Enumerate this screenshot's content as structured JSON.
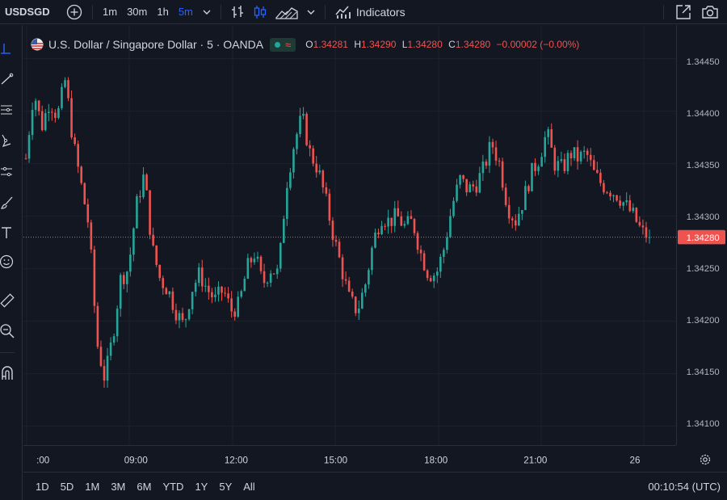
{
  "toolbar": {
    "symbol": "USDSGD",
    "intervals": [
      {
        "label": "1m",
        "active": false
      },
      {
        "label": "30m",
        "active": false
      },
      {
        "label": "1h",
        "active": false
      },
      {
        "label": "5m",
        "active": true
      }
    ],
    "indicators_label": "Indicators",
    "icons": [
      "add-symbol-icon",
      "chevron-down-icon",
      "bar-style-icon",
      "candle-style-icon",
      "area-style-icon",
      "chevron-down-icon",
      "indicators-icon",
      "fullscreen-icon",
      "camera-icon"
    ]
  },
  "legend": {
    "title": "U.S. Dollar / Singapore Dollar · 5 · OANDA",
    "ohlc": [
      {
        "k": "O",
        "v": "1.34281"
      },
      {
        "k": "H",
        "v": "1.34290"
      },
      {
        "k": "L",
        "v": "1.34280"
      },
      {
        "k": "C",
        "v": "1.34280"
      }
    ],
    "change": "−0.00002 (−0.00%)"
  },
  "left_tools": [
    "crosshair-icon",
    "trendline-icon",
    "fib-icon",
    "brush-icon",
    "pattern-icon",
    "forecast-icon",
    "text-icon",
    "emoji-icon",
    "ruler-icon",
    "zoom-icon",
    "magnet-icon"
  ],
  "bottom": {
    "ranges": [
      "1D",
      "5D",
      "1M",
      "3M",
      "6M",
      "YTD",
      "1Y",
      "5Y",
      "All"
    ],
    "clock": "00:10:54 (UTC)"
  },
  "colors": {
    "up": "#26a69a",
    "down": "#ef5350",
    "bg": "#131722",
    "grid": "#1e222d"
  },
  "chart_data": {
    "type": "candlestick",
    "price_ticks": [
      "1.34450",
      "1.34400",
      "1.34350",
      "1.34300",
      "1.34250",
      "1.34200",
      "1.34150",
      "1.34100"
    ],
    "time_ticks": [
      ":00",
      "09:00",
      "12:00",
      "15:00",
      "18:00",
      "21:00",
      "26"
    ],
    "last_price": "1.34280",
    "ylim": [
      1.34082,
      1.34482
    ],
    "close_path": [
      1.34355,
      1.3442,
      1.34385,
      1.3441,
      1.34395,
      1.3443,
      1.3437,
      1.3433,
      1.3429,
      1.3418,
      1.34145,
      1.34185,
      1.3424,
      1.3425,
      1.3431,
      1.3434,
      1.3427,
      1.3424,
      1.3423,
      1.3421,
      1.34195,
      1.3423,
      1.34245,
      1.3423,
      1.3422,
      1.3423,
      1.3421,
      1.34215,
      1.3425,
      1.34265,
      1.34235,
      1.3425,
      1.34245,
      1.3433,
      1.3437,
      1.34395,
      1.3436,
      1.34345,
      1.34315,
      1.3428,
      1.3425,
      1.3422,
      1.3421,
      1.34235,
      1.34275,
      1.343,
      1.34295,
      1.343,
      1.3429,
      1.34295,
      1.34265,
      1.34245,
      1.34245,
      1.3427,
      1.3431,
      1.34335,
      1.34325,
      1.3433,
      1.34345,
      1.3437,
      1.3435,
      1.3431,
      1.34295,
      1.34315,
      1.3434,
      1.34355,
      1.3438,
      1.3435,
      1.34345,
      1.3436,
      1.34355,
      1.3436,
      1.3434,
      1.3433,
      1.34325,
      1.3432,
      1.3431,
      1.343,
      1.34285,
      1.3428
    ]
  }
}
